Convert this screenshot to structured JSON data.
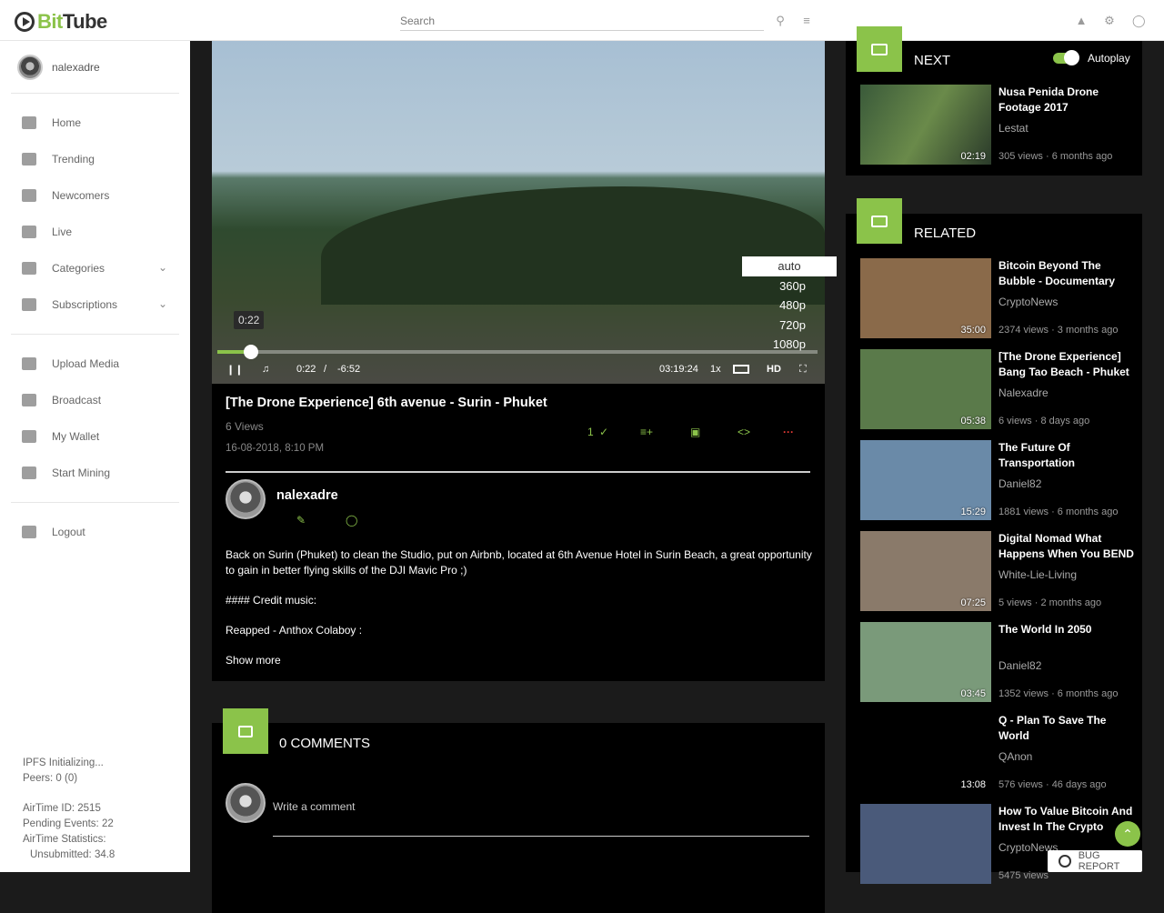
{
  "app": {
    "logo_bit": "Bit",
    "logo_tube": "Tube"
  },
  "search": {
    "placeholder": "Search"
  },
  "header_icons": [
    "search-icon",
    "filter-icon",
    "bell-icon",
    "gear-icon",
    "globe-icon"
  ],
  "sidebar": {
    "user": "nalexadre",
    "items": [
      {
        "label": "Home",
        "icon": "home-icon"
      },
      {
        "label": "Trending",
        "icon": "trending-icon"
      },
      {
        "label": "Newcomers",
        "icon": "new-icon"
      },
      {
        "label": "Live",
        "icon": "tv-icon"
      },
      {
        "label": "Categories",
        "icon": "list-icon"
      },
      {
        "label": "Subscriptions",
        "icon": "smile-icon"
      },
      {
        "label": "Upload Media",
        "icon": "cloud-upload-icon"
      },
      {
        "label": "Broadcast",
        "icon": "cast-icon"
      },
      {
        "label": "My Wallet",
        "icon": "wallet-icon"
      },
      {
        "label": "Start Mining",
        "icon": "chip-icon"
      },
      {
        "label": "Logout",
        "icon": "logout-icon"
      }
    ],
    "ipfs": [
      "IPFS Initializing...",
      "Peers: 0 (0)"
    ],
    "airtime": [
      "AirTime ID: 2515",
      "Pending Events: 22",
      "AirTime Statistics:",
      "Unsubmitted: 34.8"
    ]
  },
  "player": {
    "qualities": [
      "auto",
      "360p",
      "480p",
      "720p",
      "1080p"
    ],
    "selected_quality": "auto",
    "time_bubble": "0:22",
    "current": "0:22",
    "sep": "/",
    "remaining": "-6:52",
    "clock": "03:19:24",
    "speed": "1x",
    "hd": "HD",
    "progress": 0.05
  },
  "video": {
    "title": "[The Drone Experience] 6th avenue - Surin - Phuket",
    "views": "6 Views",
    "date": "16-08-2018, 8:10 PM",
    "likes": "1",
    "uploader": "nalexadre",
    "description": [
      "Back on Surin (Phuket) to clean the Studio, put on Airbnb, located at 6th Avenue Hotel in Surin Beach, a great opportunity to gain in better flying skills of the DJI Mavic Pro ;)",
      "#### Credit music:",
      "Reapped - Anthox Colaboy :"
    ],
    "show_more": "Show more"
  },
  "comments": {
    "title": "0 COMMENTS",
    "placeholder": "Write a comment"
  },
  "next": {
    "title": "NEXT",
    "autoplay": "Autoplay",
    "autoplay_on": true,
    "card": {
      "title": "Nusa Penida Drone Footage 2017",
      "author": "Lestat",
      "meta": "305 views · 6 months ago",
      "duration": "02:19"
    }
  },
  "related": {
    "title": "RELATED",
    "cards": [
      {
        "title": "Bitcoin Beyond The Bubble - Documentary",
        "author": "CryptoNews",
        "meta": "2374 views · 3 months ago",
        "duration": "35:00",
        "color": "#8a6a4a"
      },
      {
        "title": "[The Drone Experience] Bang Tao Beach - Phuket",
        "author": "Nalexadre",
        "meta": "6 views · 8 days ago",
        "duration": "05:38",
        "color": "#5a7a4a"
      },
      {
        "title": "The Future Of Transportation",
        "author": "Daniel82",
        "meta": "1881 views · 6 months ago",
        "duration": "15:29",
        "color": "#6a8aa8"
      },
      {
        "title": "Digital Nomad What Happens When You BEND",
        "author": "White-Lie-Living",
        "meta": "5 views · 2 months ago",
        "duration": "07:25",
        "color": "#8a7a6a"
      },
      {
        "title": "The World In 2050",
        "author": "Daniel82",
        "meta": "1352 views · 6 months ago",
        "duration": "03:45",
        "color": "#7a9a7a"
      },
      {
        "title": "Q - Plan To Save The World",
        "author": "QAnon",
        "meta": "576 views · 46 days ago",
        "duration": "13:08",
        "color": "#000000"
      },
      {
        "title": "How To Value Bitcoin And Invest In The Crypto",
        "author": "CryptoNews",
        "meta": "5475 views",
        "duration": "",
        "color": "#4a5a7a"
      }
    ]
  },
  "bug_report": "BUG REPORT",
  "colors": {
    "accent": "#8bc34a",
    "danger": "#e53935"
  }
}
